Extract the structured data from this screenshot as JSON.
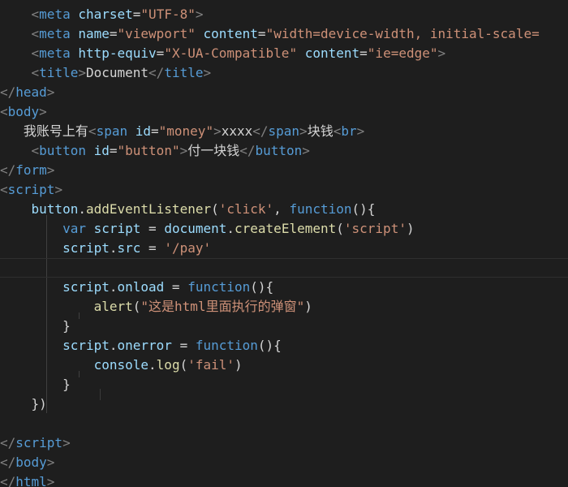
{
  "colors": {
    "background": "#1e1e1e",
    "tag_bracket": "#808080",
    "tag_name": "#569cd6",
    "attribute_name": "#9cdcfe",
    "string": "#ce9178",
    "keyword": "#569cd6",
    "function_name": "#dcdcaa",
    "plain": "#d4d4d4",
    "indent_guide": "#404040"
  },
  "code_lines": [
    {
      "tokens": [
        [
          "    ",
          "plain"
        ],
        [
          "<",
          "tag_bracket"
        ],
        [
          "meta",
          "tag_name"
        ],
        [
          " ",
          "plain"
        ],
        [
          "charset",
          "attribute_name"
        ],
        [
          "=",
          "plain"
        ],
        [
          "\"UTF-8\"",
          "string"
        ],
        [
          ">",
          "tag_bracket"
        ]
      ]
    },
    {
      "tokens": [
        [
          "    ",
          "plain"
        ],
        [
          "<",
          "tag_bracket"
        ],
        [
          "meta",
          "tag_name"
        ],
        [
          " ",
          "plain"
        ],
        [
          "name",
          "attribute_name"
        ],
        [
          "=",
          "plain"
        ],
        [
          "\"viewport\"",
          "string"
        ],
        [
          " ",
          "plain"
        ],
        [
          "content",
          "attribute_name"
        ],
        [
          "=",
          "plain"
        ],
        [
          "\"width=device-width, initial-scale=",
          "string"
        ]
      ]
    },
    {
      "tokens": [
        [
          "    ",
          "plain"
        ],
        [
          "<",
          "tag_bracket"
        ],
        [
          "meta",
          "tag_name"
        ],
        [
          " ",
          "plain"
        ],
        [
          "http-equiv",
          "attribute_name"
        ],
        [
          "=",
          "plain"
        ],
        [
          "\"X-UA-Compatible\"",
          "string"
        ],
        [
          " ",
          "plain"
        ],
        [
          "content",
          "attribute_name"
        ],
        [
          "=",
          "plain"
        ],
        [
          "\"ie=edge\"",
          "string"
        ],
        [
          ">",
          "tag_bracket"
        ]
      ]
    },
    {
      "tokens": [
        [
          "    ",
          "plain"
        ],
        [
          "<",
          "tag_bracket"
        ],
        [
          "title",
          "tag_name"
        ],
        [
          ">",
          "tag_bracket"
        ],
        [
          "Document",
          "plain"
        ],
        [
          "</",
          "tag_bracket"
        ],
        [
          "title",
          "tag_name"
        ],
        [
          ">",
          "tag_bracket"
        ]
      ]
    },
    {
      "tokens": [
        [
          "</",
          "tag_bracket"
        ],
        [
          "head",
          "tag_name"
        ],
        [
          ">",
          "tag_bracket"
        ]
      ]
    },
    {
      "tokens": [
        [
          "<",
          "tag_bracket"
        ],
        [
          "body",
          "tag_name"
        ],
        [
          ">",
          "tag_bracket"
        ]
      ]
    },
    {
      "tokens": [
        [
          "   ",
          "plain"
        ],
        [
          "我账号上有",
          "plain"
        ],
        [
          "<",
          "tag_bracket"
        ],
        [
          "span",
          "tag_name"
        ],
        [
          " ",
          "plain"
        ],
        [
          "id",
          "attribute_name"
        ],
        [
          "=",
          "plain"
        ],
        [
          "\"money\"",
          "string"
        ],
        [
          ">",
          "tag_bracket"
        ],
        [
          "xxxx",
          "plain"
        ],
        [
          "</",
          "tag_bracket"
        ],
        [
          "span",
          "tag_name"
        ],
        [
          ">",
          "tag_bracket"
        ],
        [
          "块钱",
          "plain"
        ],
        [
          "<",
          "tag_bracket"
        ],
        [
          "br",
          "tag_name"
        ],
        [
          ">",
          "tag_bracket"
        ]
      ]
    },
    {
      "tokens": [
        [
          "    ",
          "plain"
        ],
        [
          "<",
          "tag_bracket"
        ],
        [
          "button",
          "tag_name"
        ],
        [
          " ",
          "plain"
        ],
        [
          "id",
          "attribute_name"
        ],
        [
          "=",
          "plain"
        ],
        [
          "\"button\"",
          "string"
        ],
        [
          ">",
          "tag_bracket"
        ],
        [
          "付一块钱",
          "plain"
        ],
        [
          "</",
          "tag_bracket"
        ],
        [
          "button",
          "tag_name"
        ],
        [
          ">",
          "tag_bracket"
        ]
      ]
    },
    {
      "tokens": [
        [
          "</",
          "tag_bracket"
        ],
        [
          "form",
          "tag_name"
        ],
        [
          ">",
          "tag_bracket"
        ]
      ]
    },
    {
      "tokens": [
        [
          "<",
          "tag_bracket"
        ],
        [
          "script",
          "tag_name"
        ],
        [
          ">",
          "tag_bracket"
        ]
      ]
    },
    {
      "tokens": [
        [
          "    ",
          "plain"
        ],
        [
          "button",
          "attribute_name"
        ],
        [
          ".",
          "plain"
        ],
        [
          "addEventListener",
          "function_name"
        ],
        [
          "(",
          "plain"
        ],
        [
          "'click'",
          "string"
        ],
        [
          ", ",
          "plain"
        ],
        [
          "function",
          "keyword"
        ],
        [
          "(){",
          "plain"
        ]
      ]
    },
    {
      "tokens": [
        [
          "        ",
          "plain"
        ],
        [
          "var",
          "keyword"
        ],
        [
          " ",
          "plain"
        ],
        [
          "script",
          "attribute_name"
        ],
        [
          " = ",
          "plain"
        ],
        [
          "document",
          "attribute_name"
        ],
        [
          ".",
          "plain"
        ],
        [
          "createElement",
          "function_name"
        ],
        [
          "(",
          "plain"
        ],
        [
          "'script'",
          "string"
        ],
        [
          ")",
          "plain"
        ]
      ]
    },
    {
      "tokens": [
        [
          "        ",
          "plain"
        ],
        [
          "script",
          "attribute_name"
        ],
        [
          ".",
          "plain"
        ],
        [
          "src",
          "attribute_name"
        ],
        [
          " = ",
          "plain"
        ],
        [
          "'/pay'",
          "string"
        ]
      ]
    },
    {
      "tokens": [],
      "current": true
    },
    {
      "tokens": [
        [
          "        ",
          "plain"
        ],
        [
          "script",
          "attribute_name"
        ],
        [
          ".",
          "plain"
        ],
        [
          "onload",
          "attribute_name"
        ],
        [
          " = ",
          "plain"
        ],
        [
          "function",
          "keyword"
        ],
        [
          "(){",
          "plain"
        ]
      ]
    },
    {
      "tokens": [
        [
          "            ",
          "plain"
        ],
        [
          "alert",
          "function_name"
        ],
        [
          "(",
          "plain"
        ],
        [
          "\"这是html里面执行的弹窗\"",
          "string"
        ],
        [
          ")",
          "plain"
        ]
      ]
    },
    {
      "tokens": [
        [
          "        ",
          "plain"
        ],
        [
          "}",
          "plain"
        ]
      ]
    },
    {
      "tokens": [
        [
          "        ",
          "plain"
        ],
        [
          "script",
          "attribute_name"
        ],
        [
          ".",
          "plain"
        ],
        [
          "onerror",
          "attribute_name"
        ],
        [
          " = ",
          "plain"
        ],
        [
          "function",
          "keyword"
        ],
        [
          "(){",
          "plain"
        ]
      ]
    },
    {
      "tokens": [
        [
          "            ",
          "plain"
        ],
        [
          "console",
          "attribute_name"
        ],
        [
          ".",
          "plain"
        ],
        [
          "log",
          "function_name"
        ],
        [
          "(",
          "plain"
        ],
        [
          "'fail'",
          "string"
        ],
        [
          ")",
          "plain"
        ]
      ]
    },
    {
      "tokens": [
        [
          "        ",
          "plain"
        ],
        [
          "}",
          "plain"
        ]
      ]
    },
    {
      "tokens": [
        [
          "    ",
          "plain"
        ],
        [
          "})",
          "plain"
        ]
      ]
    },
    {
      "tokens": []
    },
    {
      "tokens": [
        [
          "</",
          "tag_bracket"
        ],
        [
          "script",
          "tag_name"
        ],
        [
          ">",
          "tag_bracket"
        ]
      ]
    },
    {
      "tokens": [
        [
          "</",
          "tag_bracket"
        ],
        [
          "body",
          "tag_name"
        ],
        [
          ">",
          "tag_bracket"
        ]
      ]
    },
    {
      "tokens": [
        [
          "</",
          "tag_bracket"
        ],
        [
          "html",
          "tag_name"
        ],
        [
          ">",
          "tag_bracket"
        ]
      ]
    }
  ]
}
